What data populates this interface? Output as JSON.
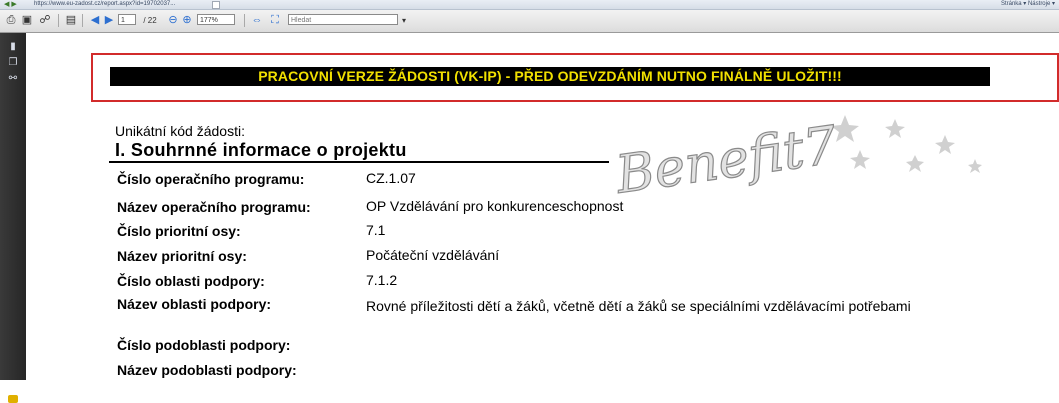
{
  "browser": {
    "url": "https://www.eu-zadost.cz/report.aspx?id=19702037...",
    "tools_right": "Stránka ▾  Nástroje ▾"
  },
  "toolbar": {
    "page_current": "1",
    "page_total": "/ 22",
    "zoom": "177%",
    "find_placeholder": "Hledat"
  },
  "document": {
    "banner": "PRACOVNÍ VERZE ŽÁDOSTI (VK-IP) - PŘED ODEVZDÁNÍM NUTNO FINÁLNĚ ULOŽIT!!!",
    "watermark": "Benefit7",
    "unique_code_label": "Unikátní kód žádosti:",
    "section_title": "I. Souhrnné informace o projektu",
    "fields": [
      {
        "label": "Číslo operačního programu:",
        "value": "CZ.1.07"
      },
      {
        "label": "Název operačního programu:",
        "value": "OP Vzdělávání pro konkurenceschopnost"
      },
      {
        "label": "Číslo prioritní osy:",
        "value": "7.1"
      },
      {
        "label": "Název prioritní osy:",
        "value": "Počáteční vzdělávání"
      },
      {
        "label": "Číslo oblasti podpory:",
        "value": "7.1.2"
      },
      {
        "label": "Název oblasti podpory:",
        "value": "Rovné příležitosti dětí a žáků, včetně dětí a žáků se speciálními vzdělávacími potřebami"
      },
      {
        "label": "Číslo podoblasti podpory:",
        "value": ""
      },
      {
        "label": "Název podoblasti podpory:",
        "value": ""
      }
    ]
  }
}
